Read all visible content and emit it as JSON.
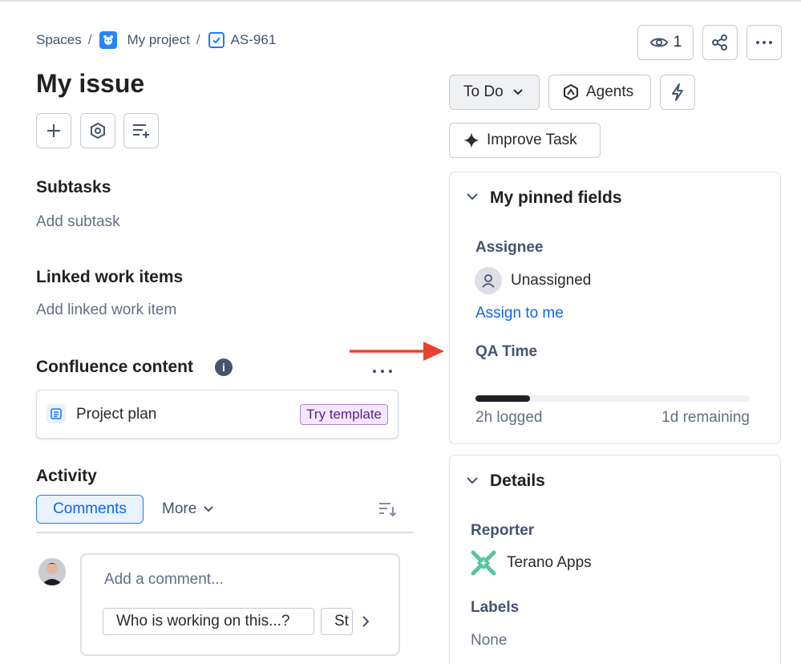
{
  "breadcrumb": {
    "spaces": "Spaces",
    "project": "My project",
    "issue_key": "AS-961"
  },
  "issue": {
    "title": "My issue"
  },
  "toolbar": {
    "watchers_count": "1"
  },
  "subtasks": {
    "heading": "Subtasks",
    "add": "Add subtask"
  },
  "linked": {
    "heading": "Linked work items",
    "add": "Add linked work item"
  },
  "confluence": {
    "heading": "Confluence content",
    "item_title": "Project plan",
    "badge": "Try template"
  },
  "activity": {
    "heading": "Activity",
    "tab_comments": "Comments",
    "tab_more": "More",
    "comment_placeholder": "Add a comment...",
    "suggestions": [
      "Who is working on this...?",
      "St"
    ]
  },
  "actions": {
    "status": "To Do",
    "agents": "Agents",
    "improve": "Improve Task"
  },
  "pinned": {
    "heading": "My pinned fields",
    "assignee_label": "Assignee",
    "assignee_value": "Unassigned",
    "assign_to_me": "Assign to me",
    "qa_label": "QA Time",
    "logged": "2h logged",
    "remaining": "1d remaining",
    "progress_fraction": 0.2
  },
  "details": {
    "heading": "Details",
    "reporter_label": "Reporter",
    "reporter_value": "Terano Apps",
    "labels_label": "Labels",
    "labels_value": "None"
  },
  "colors": {
    "accent": "#0c66e4",
    "annotation_arrow": "#e5432f",
    "terano_green": "#57c4a0"
  }
}
